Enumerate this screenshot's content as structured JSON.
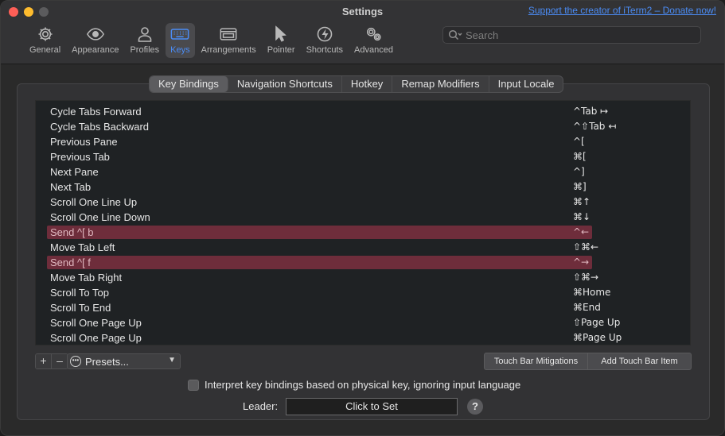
{
  "window": {
    "title": "Settings",
    "support_link": "Support the creator of iTerm2 – Donate now!"
  },
  "toolbar": [
    {
      "label": "General",
      "icon": "gear-icon",
      "active": false
    },
    {
      "label": "Appearance",
      "icon": "eye-icon",
      "active": false
    },
    {
      "label": "Profiles",
      "icon": "person-icon",
      "active": false
    },
    {
      "label": "Keys",
      "icon": "keyboard-icon",
      "active": true
    },
    {
      "label": "Arrangements",
      "icon": "window-icon",
      "active": false
    },
    {
      "label": "Pointer",
      "icon": "pointer-icon",
      "active": false
    },
    {
      "label": "Shortcuts",
      "icon": "bolt-icon",
      "active": false
    },
    {
      "label": "Advanced",
      "icon": "gears-icon",
      "active": false
    }
  ],
  "search": {
    "placeholder": "Search",
    "value": ""
  },
  "tabs": [
    {
      "label": "Key Bindings",
      "active": true
    },
    {
      "label": "Navigation Shortcuts",
      "active": false
    },
    {
      "label": "Hotkey",
      "active": false
    },
    {
      "label": "Remap Modifiers",
      "active": false
    },
    {
      "label": "Locale",
      "active": false
    }
  ],
  "bindings": [
    {
      "action": "Cycle Tabs Forward",
      "key": "^Tab ↦",
      "highlighted": false
    },
    {
      "action": "Cycle Tabs Backward",
      "key": "^⇧Tab ↤",
      "highlighted": false
    },
    {
      "action": "Previous Pane",
      "key": "^[",
      "highlighted": false
    },
    {
      "action": "Previous Tab",
      "key": "⌘[",
      "highlighted": false
    },
    {
      "action": "Next Pane",
      "key": "^]",
      "highlighted": false
    },
    {
      "action": "Next Tab",
      "key": "⌘]",
      "highlighted": false
    },
    {
      "action": "Scroll One Line Up",
      "key": "⌘↑",
      "highlighted": false
    },
    {
      "action": "Scroll One Line Down",
      "key": "⌘↓",
      "highlighted": false
    },
    {
      "action": "Send ^[ b",
      "key": "^←",
      "highlighted": true
    },
    {
      "action": "Move Tab Left",
      "key": "⇧⌘←",
      "highlighted": false
    },
    {
      "action": "Send ^[ f",
      "key": "^→",
      "highlighted": true
    },
    {
      "action": "Move Tab Right",
      "key": "⇧⌘→",
      "highlighted": false
    },
    {
      "action": "Scroll To Top",
      "key": "⌘Home",
      "highlighted": false
    },
    {
      "action": "Scroll To End",
      "key": "⌘End",
      "highlighted": false
    },
    {
      "action": "Scroll One Page Up",
      "key": "⇧Page Up",
      "highlighted": false
    },
    {
      "action": "Scroll One Page Up",
      "key": "⌘Page Up",
      "highlighted": false
    }
  ],
  "controls": {
    "add_label": "+",
    "remove_label": "–",
    "presets_label": "Presets...",
    "touch_bar_mitigations": "Touch Bar Mitigations",
    "add_touch_bar_item": "Add Touch Bar Item",
    "physical_key_checkbox": "Interpret key bindings based on physical key, ignoring input language",
    "physical_key_checked": false,
    "leader_label": "Leader:",
    "leader_button": "Click to Set",
    "help_label": "?"
  },
  "colors": {
    "accent": "#4b8cf5",
    "highlight_row": "#6e2d3b",
    "link": "#4b8cf5"
  }
}
